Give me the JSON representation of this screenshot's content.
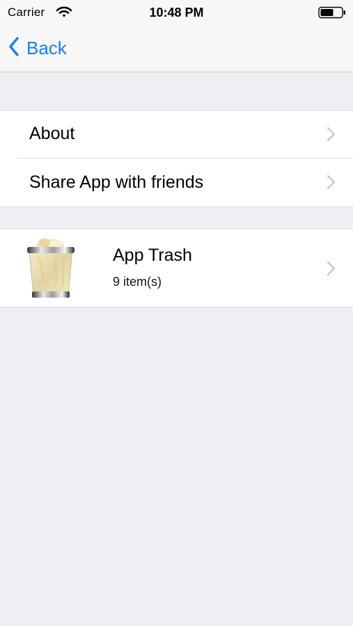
{
  "status_bar": {
    "carrier": "Carrier",
    "time": "10:48 PM",
    "wifi_icon": "wifi-icon",
    "battery_icon": "battery-icon"
  },
  "nav": {
    "back_label": "Back",
    "back_icon": "chevron-left-icon"
  },
  "settings": {
    "rows": [
      {
        "label": "About",
        "icon": "chevron-right-icon"
      },
      {
        "label": "Share App with friends",
        "icon": "chevron-right-icon"
      }
    ]
  },
  "trash": {
    "title": "App Trash",
    "count": "9 item(s)",
    "icon": "trash-can-icon"
  },
  "colors": {
    "accent": "#147efb",
    "background": "#efeff4",
    "chevron": "#c7c7cc"
  }
}
